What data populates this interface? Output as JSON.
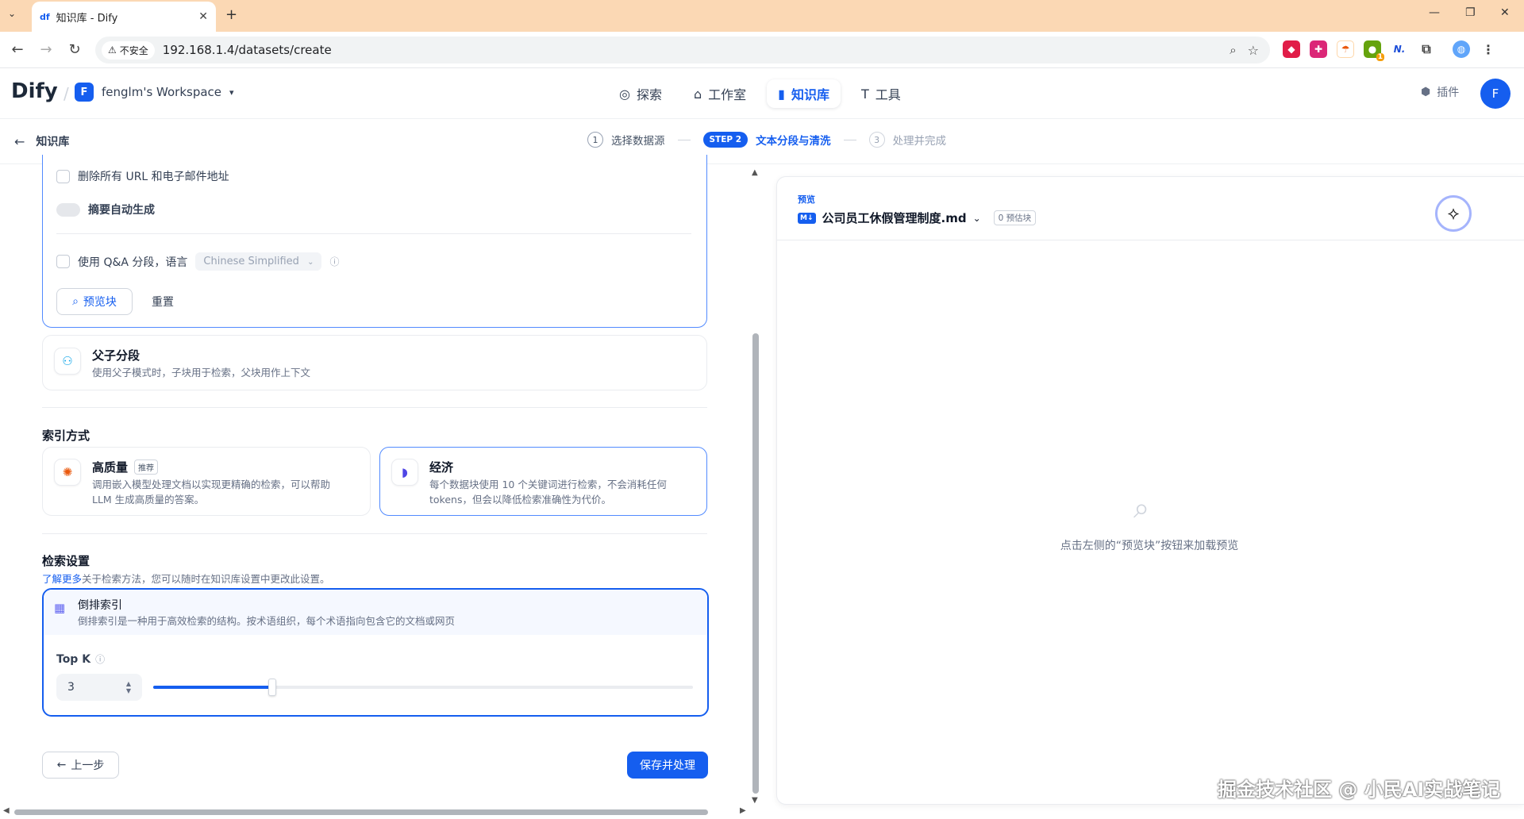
{
  "browser": {
    "tab_title": "知识库 - Dify",
    "tab_favicon": "df",
    "insecure_label": "不安全",
    "url": "192.168.1.4/datasets/create",
    "ext_badge": "1",
    "ext_nv": "N."
  },
  "app": {
    "logo": "Dify",
    "workspace_initial": "F",
    "workspace_name": "fenglm's Workspace",
    "nav": [
      {
        "label": "探索"
      },
      {
        "label": "工作室"
      },
      {
        "label": "知识库"
      },
      {
        "label": "工具"
      }
    ],
    "plugins_label": "插件",
    "avatar_initial": "F"
  },
  "steps": {
    "back_label": "知识库",
    "step1_num": "1",
    "step1_label": "选择数据源",
    "step2_badge": "STEP 2",
    "step2_label": "文本分段与清洗",
    "step3_num": "3",
    "step3_label": "处理并完成"
  },
  "segment": {
    "remove_urls_label": "删除所有 URL 和电子邮件地址",
    "auto_summary_label": "摘要自动生成",
    "qa_label": "使用 Q&A 分段，语言",
    "qa_language": "Chinese Simplified",
    "preview_button": "预览块",
    "reset_button": "重置",
    "parent_child_title": "父子分段",
    "parent_child_desc": "使用父子模式时，子块用于检索，父块用作上下文"
  },
  "index": {
    "heading": "索引方式",
    "high_quality_title": "高质量",
    "high_quality_badge": "推荐",
    "high_quality_desc1": "调用嵌入模型处理文档以实现更精确的检索，可以帮助",
    "high_quality_desc2": "LLM 生成高质量的答案。",
    "economy_title": "经济",
    "economy_desc1": "每个数据块使用 10 个关键词进行检索，不会消耗任何",
    "economy_desc2": "tokens，但会以降低检索准确性为代价。"
  },
  "retrieval": {
    "heading": "检索设置",
    "learn_more": "了解更多",
    "desc": "关于检索方法，您可以随时在知识库设置中更改此设置。",
    "inverted_title": "倒排索引",
    "inverted_desc": "倒排索引是一种用于高效检索的结构。按术语组织，每个术语指向包含它的文档或网页",
    "topk_label": "Top K",
    "topk_value": "3",
    "topk_slider_fraction": 0.22
  },
  "footer": {
    "prev_button": "上一步",
    "save_button": "保存并处理"
  },
  "preview": {
    "label": "预览",
    "md_badge": "M↓",
    "file_name": "公司员工休假管理制度.md",
    "chunk_count": "0 预估块",
    "empty_text": "点击左侧的“预览块”按钮来加载预览"
  },
  "watermark": "掘金技术社区 @ 小民AI实战笔记",
  "colors": {
    "primary": "#155eef",
    "tabbar": "#fbd8b4",
    "border": "#eaecf0"
  }
}
